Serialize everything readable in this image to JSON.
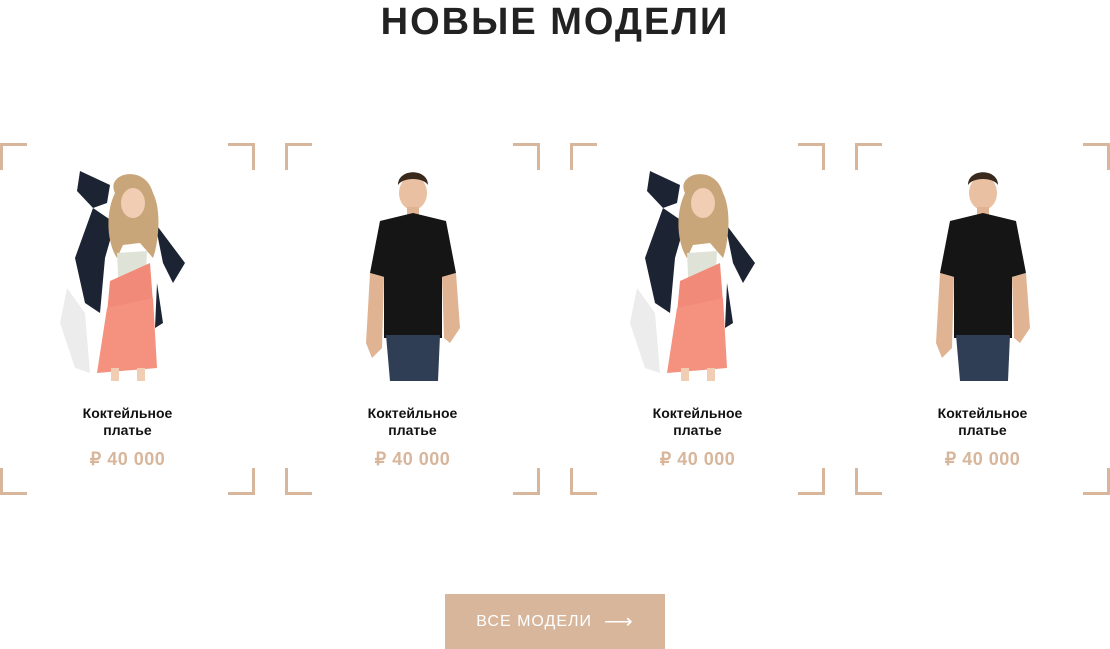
{
  "section": {
    "title": "НОВЫЕ МОДЕЛИ"
  },
  "products": [
    {
      "name_line1": "Коктейльное",
      "name_line2": "платье",
      "price": "₽ 40 000",
      "image": "woman-model-photo"
    },
    {
      "name_line1": "Коктейльное",
      "name_line2": "платье",
      "price": "₽ 40 000",
      "image": "man-model-photo"
    },
    {
      "name_line1": "Коктейльное",
      "name_line2": "платье",
      "price": "₽ 40 000",
      "image": "woman-model-photo"
    },
    {
      "name_line1": "Коктейльное",
      "name_line2": "платье",
      "price": "₽ 40 000",
      "image": "man-model-photo"
    }
  ],
  "cta": {
    "label": "ВСЕ МОДЕЛИ",
    "icon": "arrow-right-icon"
  },
  "colors": {
    "accent": "#d7b69b",
    "text": "#222222",
    "background": "#ffffff"
  }
}
